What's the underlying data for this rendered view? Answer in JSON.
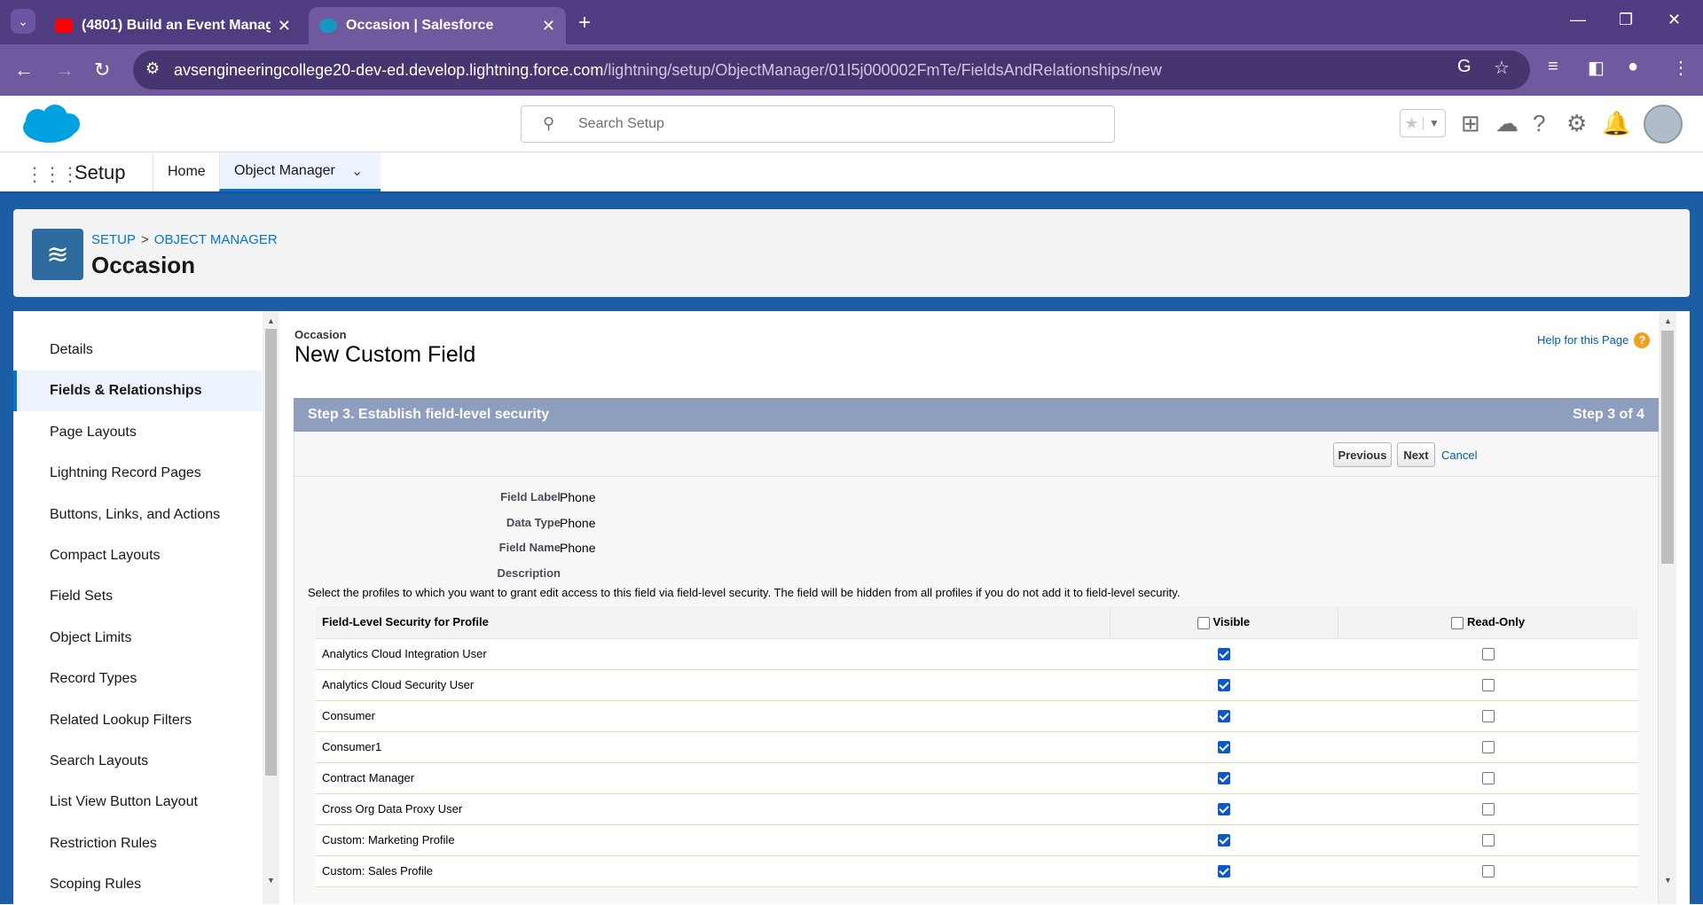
{
  "browser": {
    "tabs": [
      {
        "title": "(4801) Build an Event Manager",
        "favicon_color": "#ff0000"
      },
      {
        "title": "Occasion | Salesforce",
        "favicon_color": "#1798c1"
      }
    ],
    "url_host": "avsengineeringcollege20-dev-ed.develop.lightning.force.com",
    "url_path": "/lightning/setup/ObjectManager/01I5j000002FmTe/FieldsAndRelationships/new"
  },
  "header": {
    "search_placeholder": "Search Setup"
  },
  "nav": {
    "app_name": "Setup",
    "items": [
      {
        "label": "Home"
      },
      {
        "label": "Object Manager"
      }
    ]
  },
  "object_header": {
    "breadcrumb_setup": "SETUP",
    "breadcrumb_sep": ">",
    "breadcrumb_object_manager": "OBJECT MANAGER",
    "title": "Occasion"
  },
  "sidebar": {
    "items": [
      {
        "label": "Details"
      },
      {
        "label": "Fields & Relationships"
      },
      {
        "label": "Page Layouts"
      },
      {
        "label": "Lightning Record Pages"
      },
      {
        "label": "Buttons, Links, and Actions"
      },
      {
        "label": "Compact Layouts"
      },
      {
        "label": "Field Sets"
      },
      {
        "label": "Object Limits"
      },
      {
        "label": "Record Types"
      },
      {
        "label": "Related Lookup Filters"
      },
      {
        "label": "Search Layouts"
      },
      {
        "label": "List View Button Layout"
      },
      {
        "label": "Restriction Rules"
      },
      {
        "label": "Scoping Rules"
      }
    ],
    "active": "Fields & Relationships"
  },
  "main": {
    "object_label": "Occasion",
    "page_title": "New Custom Field",
    "help_link": "Help for this Page",
    "step_title": "Step 3. Establish field-level security",
    "step_count": "Step 3 of 4",
    "buttons": {
      "previous": "Previous",
      "next": "Next",
      "cancel": "Cancel"
    },
    "fields": [
      {
        "label": "Field Label",
        "value": "Phone"
      },
      {
        "label": "Data Type",
        "value": "Phone"
      },
      {
        "label": "Field Name",
        "value": "Phone"
      },
      {
        "label": "Description",
        "value": ""
      }
    ],
    "instructions": "Select the profiles to which you want to grant edit access to this field via field-level security. The field will be hidden from all profiles if you do not add it to field-level security.",
    "table": {
      "headers": {
        "profile": "Field-Level Security for Profile",
        "visible": "Visible",
        "read_only": "Read-Only"
      },
      "rows": [
        {
          "profile": "Analytics Cloud Integration User",
          "visible": true,
          "read_only": false
        },
        {
          "profile": "Analytics Cloud Security User",
          "visible": true,
          "read_only": false
        },
        {
          "profile": "Consumer",
          "visible": true,
          "read_only": false
        },
        {
          "profile": "Consumer1",
          "visible": true,
          "read_only": false
        },
        {
          "profile": "Contract Manager",
          "visible": true,
          "read_only": false
        },
        {
          "profile": "Cross Org Data Proxy User",
          "visible": true,
          "read_only": false
        },
        {
          "profile": "Custom: Marketing Profile",
          "visible": true,
          "read_only": false
        },
        {
          "profile": "Custom: Sales Profile",
          "visible": true,
          "read_only": false
        }
      ]
    }
  }
}
